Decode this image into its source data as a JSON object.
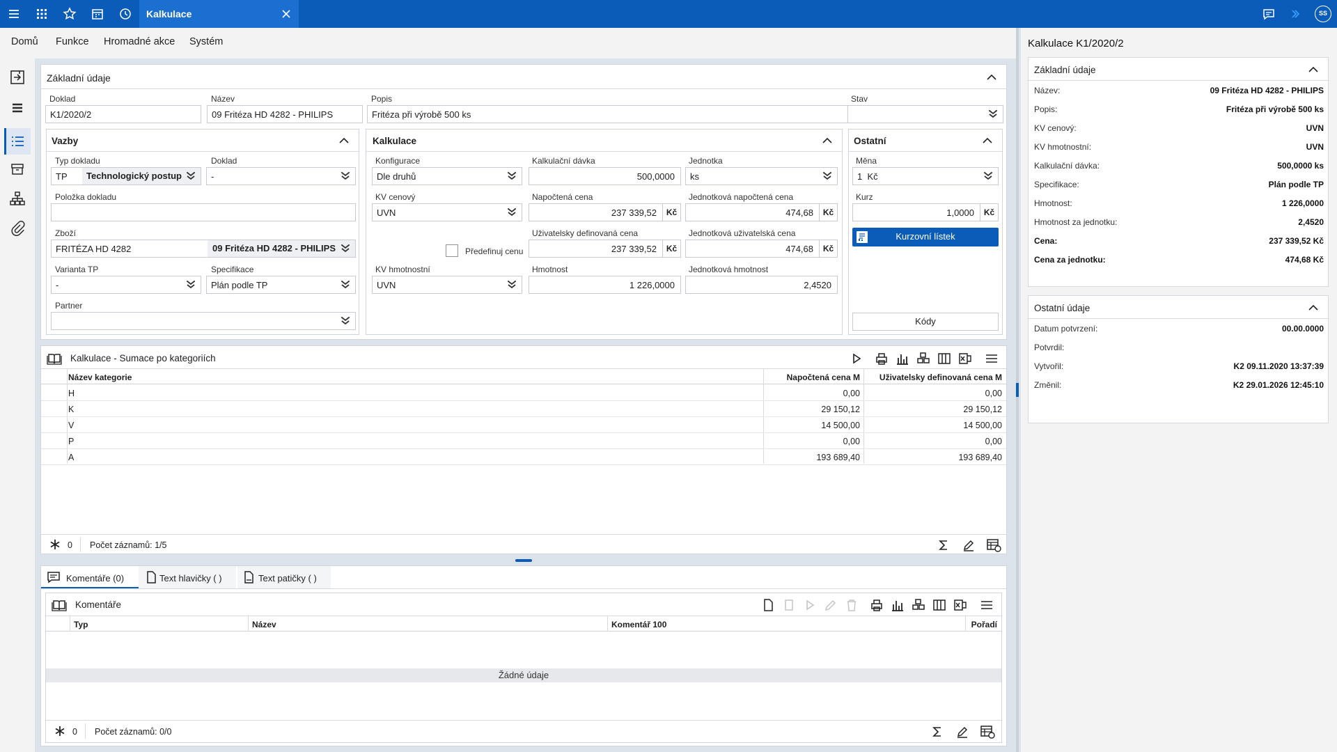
{
  "topbar": {
    "tab_title": "Kalkulace",
    "user_initials": "SS",
    "icons": [
      "hamburger-icon",
      "apps-grid-icon",
      "star-icon",
      "calendar-icon",
      "history-icon",
      "chat-icon",
      "arrow-icon",
      "user-avatar"
    ]
  },
  "menu": {
    "items": [
      "Domů",
      "Funkce",
      "Hromadné akce",
      "Systém"
    ]
  },
  "zakladni": {
    "title": "Základní údaje",
    "doklad_label": "Doklad",
    "doklad_value": "K1/2020/2",
    "nazev_label": "Název",
    "nazev_value": "09 Fritéza HD 4282 - PHILIPS",
    "popis_label": "Popis",
    "popis_value": "Fritéza při výrobě 500 ks",
    "stav_label": "Stav",
    "stav_value": ""
  },
  "vazby": {
    "title": "Vazby",
    "typ_dokladu_label": "Typ dokladu",
    "typ_dokladu_code": "TP",
    "typ_dokladu_value": "Technologický postup",
    "doklad_label": "Doklad",
    "doklad_value": "-",
    "polozka_label": "Položka dokladu",
    "polozka_value": "",
    "zbozi_label": "Zboží",
    "zbozi_code": "FRITÉZA HD 4282",
    "zbozi_value": "09 Fritéza HD 4282 - PHILIPS",
    "varianta_label": "Varianta TP",
    "varianta_value": "-",
    "specifikace_label": "Specifikace",
    "specifikace_value": "Plán podle TP",
    "partner_label": "Partner",
    "partner_value": ""
  },
  "kalkulace": {
    "title": "Kalkulace",
    "konfigurace_label": "Konfigurace",
    "konfigurace_value": "Dle druhů",
    "davka_label": "Kalkulační dávka",
    "davka_value": "500,0000",
    "jednotka_label": "Jednotka",
    "jednotka_value": "ks",
    "kv_cenovy_label": "KV cenový",
    "kv_cenovy_value": "UVN",
    "napoctena_label": "Napočtená cena",
    "napoctena_value": "237 339,52",
    "jedn_napoctena_label": "Jednotková napočtená cena",
    "jedn_napoctena_value": "474,68",
    "predefinuj_label": "Předefinuj cenu",
    "uziv_cena_label": "Uživatelsky definovaná cena",
    "uziv_cena_value": "237 339,52",
    "jedn_uziv_label": "Jednotková uživatelská cena",
    "jedn_uziv_value": "474,68",
    "kv_hmot_label": "KV hmotnostní",
    "kv_hmot_value": "UVN",
    "hmotnost_label": "Hmotnost",
    "hmotnost_value": "1 226,0000",
    "jedn_hmot_label": "Jednotková hmotnost",
    "jedn_hmot_value": "2,4520",
    "currency": "Kč"
  },
  "ostatni": {
    "title": "Ostatní",
    "mena_label": "Měna",
    "mena_value": "1  Kč",
    "kurz_label": "Kurz",
    "kurz_value": "1,0000",
    "kurz_suffix": "Kč",
    "kurzovni_button": "Kurzovní lístek",
    "kody_button": "Kódy"
  },
  "sumace": {
    "title": "Kalkulace - Sumace po kategoriích",
    "columns": [
      "Název kategorie",
      "Napočtená cena M",
      "Uživatelsky definovaná cena M"
    ],
    "rows": [
      {
        "kategorie": "H",
        "napoctena": "0,00",
        "uziv": "0,00"
      },
      {
        "kategorie": "K",
        "napoctena": "29 150,12",
        "uziv": "29 150,12"
      },
      {
        "kategorie": "V",
        "napoctena": "14 500,00",
        "uziv": "14 500,00"
      },
      {
        "kategorie": "P",
        "napoctena": "0,00",
        "uziv": "0,00"
      },
      {
        "kategorie": "A",
        "napoctena": "193 689,40",
        "uziv": "193 689,40"
      }
    ],
    "filter_count": "0",
    "record_count": "Počet záznamů: 1/5"
  },
  "tabs": {
    "items": [
      "Komentáře (0)",
      "Text hlavičky ( )",
      "Text patičky ( )"
    ]
  },
  "komentare": {
    "title": "Komentáře",
    "columns": [
      "Typ",
      "Název",
      "Komentář 100",
      "Pořadí"
    ],
    "empty_text": "Žádné údaje",
    "filter_count": "0",
    "record_count": "Počet záznamů: 0/0"
  },
  "right": {
    "title": "Kalkulace K1/2020/2",
    "zakladni_title": "Základní údaje",
    "zakladni_rows": [
      {
        "label": "Název:",
        "value": "09 Fritéza HD 4282 - PHILIPS",
        "bold": false
      },
      {
        "label": "Popis:",
        "value": "Fritéza při výrobě 500 ks",
        "bold": false
      },
      {
        "label": "KV cenový:",
        "value": "UVN",
        "bold": false
      },
      {
        "label": "KV hmotnostní:",
        "value": "UVN",
        "bold": false
      },
      {
        "label": "Kalkulační dávka:",
        "value": "500,0000 ks",
        "bold": false
      },
      {
        "label": "Specifikace:",
        "value": "Plán podle TP",
        "bold": false
      },
      {
        "label": "Hmotnost:",
        "value": "1 226,0000",
        "bold": false
      },
      {
        "label": "Hmotnost za jednotku:",
        "value": "2,4520",
        "bold": false
      },
      {
        "label": "Cena:",
        "value": "237 339,52 Kč",
        "bold": true
      },
      {
        "label": "Cena za jednotku:",
        "value": "474,68 Kč",
        "bold": true
      }
    ],
    "ostatni_title": "Ostatní údaje",
    "ostatni_rows": [
      {
        "label": "Datum potvrzení:",
        "value": "00.00.0000"
      },
      {
        "label": "Potvrdil:",
        "value": ""
      },
      {
        "label": "Vytvořil:",
        "value": "K2 09.11.2020 13:37:39"
      },
      {
        "label": "Změnil:",
        "value": "K2 29.01.2026 12:45:10"
      }
    ]
  }
}
